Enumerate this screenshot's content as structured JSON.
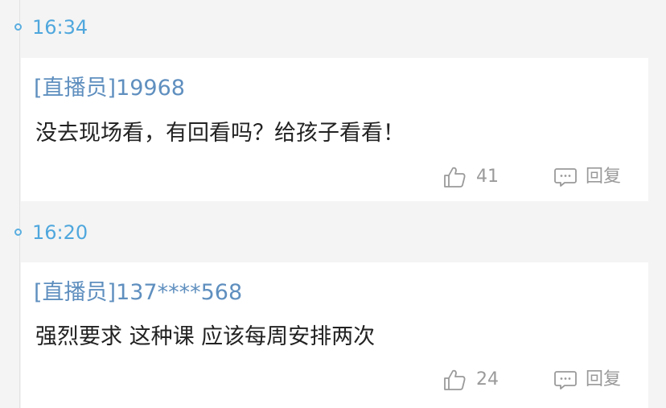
{
  "colors": {
    "background": "#f4f4f4",
    "time_accent": "#4fa7dd",
    "username": "#5f8fbf",
    "comment_text": "#222222",
    "meta_text": "#9a9a9a"
  },
  "comments": [
    {
      "time": "16:34",
      "user": "[直播员]19968",
      "text": "没去现场看，有回看吗？给孩子看看！",
      "like_icon": "thumbs-up-icon",
      "likes": "41",
      "reply_icon": "comment-bubble-icon",
      "reply_label": "回复"
    },
    {
      "time": "16:20",
      "user": "[直播员]137****568",
      "text": "强烈要求  这种课 应该每周安排两次",
      "like_icon": "thumbs-up-icon",
      "likes": "24",
      "reply_icon": "comment-bubble-icon",
      "reply_label": "回复"
    }
  ]
}
